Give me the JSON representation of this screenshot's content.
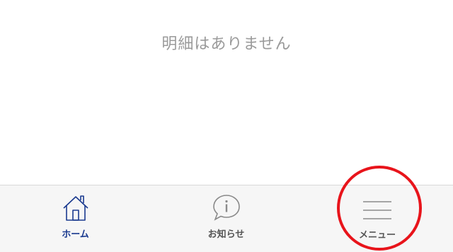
{
  "main": {
    "empty_message": "明細はありません"
  },
  "tabbar": {
    "tabs": [
      {
        "label": "ホーム",
        "icon": "home-icon",
        "active": true
      },
      {
        "label": "お知らせ",
        "icon": "info-bubble-icon",
        "active": false
      },
      {
        "label": "メニュー",
        "icon": "hamburger-menu-icon",
        "active": false
      }
    ]
  },
  "colors": {
    "active_tab": "#1a3a8f",
    "inactive_tab": "#555555",
    "tabbar_bg": "#f6f6f6",
    "empty_text": "#9a9a9a",
    "highlight_ring": "#e8141b"
  }
}
